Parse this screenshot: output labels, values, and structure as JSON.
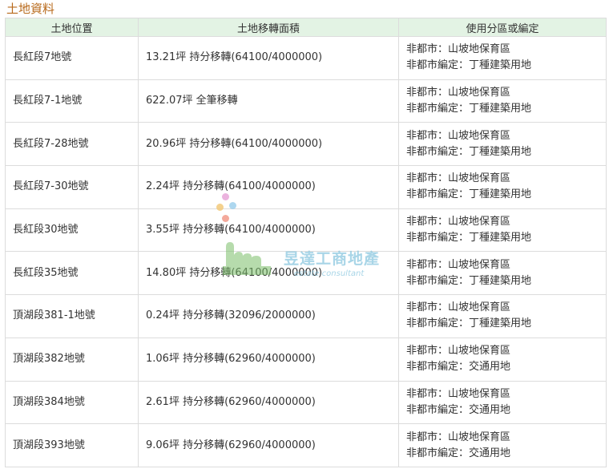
{
  "section_title": "土地資料",
  "table": {
    "headers": [
      "土地位置",
      "土地移轉面積",
      "使用分區或編定"
    ],
    "rows": [
      {
        "location": "長紅段7地號",
        "area": "13.21坪 持分移轉(64100/4000000)",
        "zone_line1": "非都市：山坡地保育區",
        "zone_line2": "非都市編定：丁種建築用地"
      },
      {
        "location": "長紅段7-1地號",
        "area": "622.07坪 全筆移轉",
        "zone_line1": "非都市：山坡地保育區",
        "zone_line2": "非都市編定：丁種建築用地"
      },
      {
        "location": "長紅段7-28地號",
        "area": "20.96坪 持分移轉(64100/4000000)",
        "zone_line1": "非都市：山坡地保育區",
        "zone_line2": "非都市編定：丁種建築用地"
      },
      {
        "location": "長紅段7-30地號",
        "area": "2.24坪 持分移轉(64100/4000000)",
        "zone_line1": "非都市：山坡地保育區",
        "zone_line2": "非都市編定：丁種建築用地"
      },
      {
        "location": "長紅段30地號",
        "area": "3.55坪 持分移轉(64100/4000000)",
        "zone_line1": "非都市：山坡地保育區",
        "zone_line2": "非都市編定：丁種建築用地"
      },
      {
        "location": "長紅段35地號",
        "area": "14.80坪 持分移轉(64100/4000000)",
        "zone_line1": "非都市：山坡地保育區",
        "zone_line2": "非都市編定：丁種建築用地"
      },
      {
        "location": "頂湖段381-1地號",
        "area": "0.24坪 持分移轉(32096/2000000)",
        "zone_line1": "非都市：山坡地保育區",
        "zone_line2": "非都市編定：丁種建築用地"
      },
      {
        "location": "頂湖段382地號",
        "area": "1.06坪 持分移轉(62960/4000000)",
        "zone_line1": "非都市：山坡地保育區",
        "zone_line2": "非都市編定：交通用地"
      },
      {
        "location": "頂湖段384地號",
        "area": "2.61坪 持分移轉(62960/4000000)",
        "zone_line1": "非都市：山坡地保育區",
        "zone_line2": "非都市編定：交通用地"
      },
      {
        "location": "頂湖段393地號",
        "area": "9.06坪 持分移轉(62960/4000000)",
        "zone_line1": "非都市：山坡地保育區",
        "zone_line2": "非都市編定：交通用地"
      }
    ]
  },
  "watermark": {
    "text": "昱達工商地產",
    "subtext": "estate consultant"
  },
  "colors": {
    "title": "#b86a1c",
    "header_bg": "#e3f3e4",
    "border": "#dcdcdc",
    "watermark": "#8cc8e0"
  }
}
